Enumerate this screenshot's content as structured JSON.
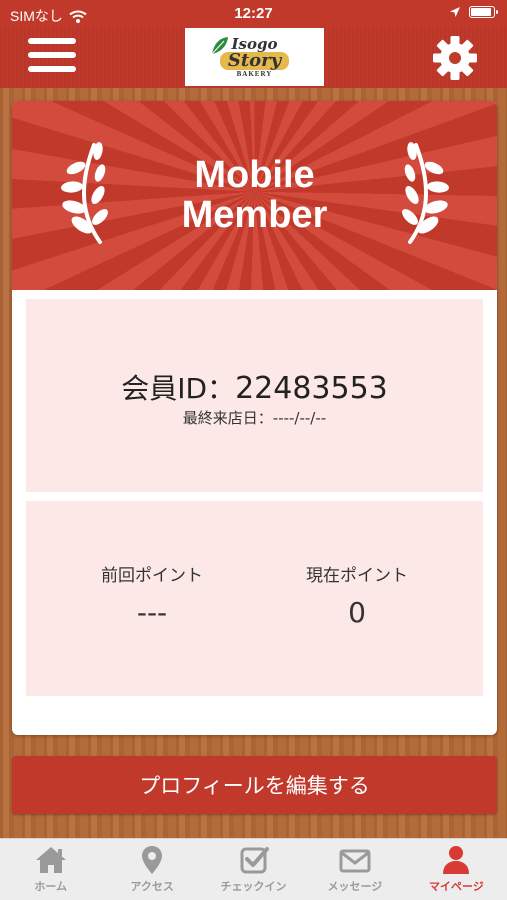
{
  "status_bar": {
    "carrier": "SIMなし",
    "time": "12:27"
  },
  "header": {
    "logo": {
      "line1": "Isogo",
      "line2": "Story",
      "sub": "BAKERY"
    }
  },
  "card": {
    "banner": {
      "line1": "Mobile",
      "line2": "Member"
    },
    "member": {
      "id_label": "会員ID：",
      "id_value": "22483553",
      "last_visit": "最終来店日：----/--/--"
    },
    "points": {
      "previous_label": "前回ポイント",
      "previous_value": "---",
      "current_label": "現在ポイント",
      "current_value": "0"
    }
  },
  "edit_button": {
    "label": "プロフィールを編集する"
  },
  "tabbar": {
    "items": [
      {
        "label": "ホーム",
        "icon": "home-icon",
        "active": false
      },
      {
        "label": "アクセス",
        "icon": "map-pin-icon",
        "active": false
      },
      {
        "label": "チェックイン",
        "icon": "checkin-icon",
        "active": false
      },
      {
        "label": "メッセージ",
        "icon": "envelope-icon",
        "active": false
      },
      {
        "label": "マイページ",
        "icon": "person-icon",
        "active": true
      }
    ]
  },
  "colors": {
    "primary": "#c0392b",
    "panel": "#fde8e8",
    "tab_active": "#d83a34",
    "tab_inactive": "#9a9a9a"
  }
}
